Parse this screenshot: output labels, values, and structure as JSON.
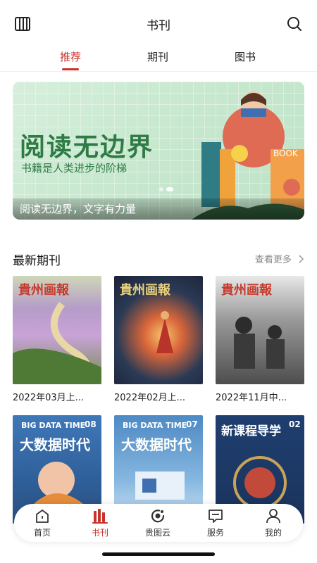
{
  "header": {
    "title": "书刊",
    "library_icon": "library-icon",
    "search_icon": "search-icon"
  },
  "tabs": [
    {
      "label": "推荐",
      "active": true
    },
    {
      "label": "期刊",
      "active": false
    },
    {
      "label": "图书",
      "active": false
    }
  ],
  "banner": {
    "headline": "阅读无边界",
    "subline": "书籍是人类进步的阶梯",
    "caption": "阅读无边界，文字有力量",
    "art_text": "BOOK"
  },
  "latest": {
    "title": "最新期刊",
    "more_label": "查看更多",
    "items": [
      {
        "label": "2022年03月上...",
        "masthead": "貴州画報"
      },
      {
        "label": "2022年02月上...",
        "masthead": "貴州画報"
      },
      {
        "label": "2022年11月中...",
        "masthead": "貴州画報"
      }
    ],
    "second_row": [
      {
        "masthead": "BIG DATA TIME",
        "issue": "08",
        "subtitle": "大数据时代"
      },
      {
        "masthead": "BIG DATA TIME",
        "issue": "07",
        "subtitle": "大数据时代"
      },
      {
        "masthead": "新课程导学",
        "issue": "02"
      }
    ]
  },
  "bottom_nav": [
    {
      "label": "首页",
      "icon": "home-icon",
      "active": false
    },
    {
      "label": "书刊",
      "icon": "books-icon",
      "active": true
    },
    {
      "label": "贵图云",
      "icon": "cloud-icon",
      "active": false
    },
    {
      "label": "服务",
      "icon": "service-icon",
      "active": false
    },
    {
      "label": "我的",
      "icon": "profile-icon",
      "active": false
    }
  ],
  "colors": {
    "accent": "#c8322b",
    "banner_green": "#2e7b45"
  }
}
